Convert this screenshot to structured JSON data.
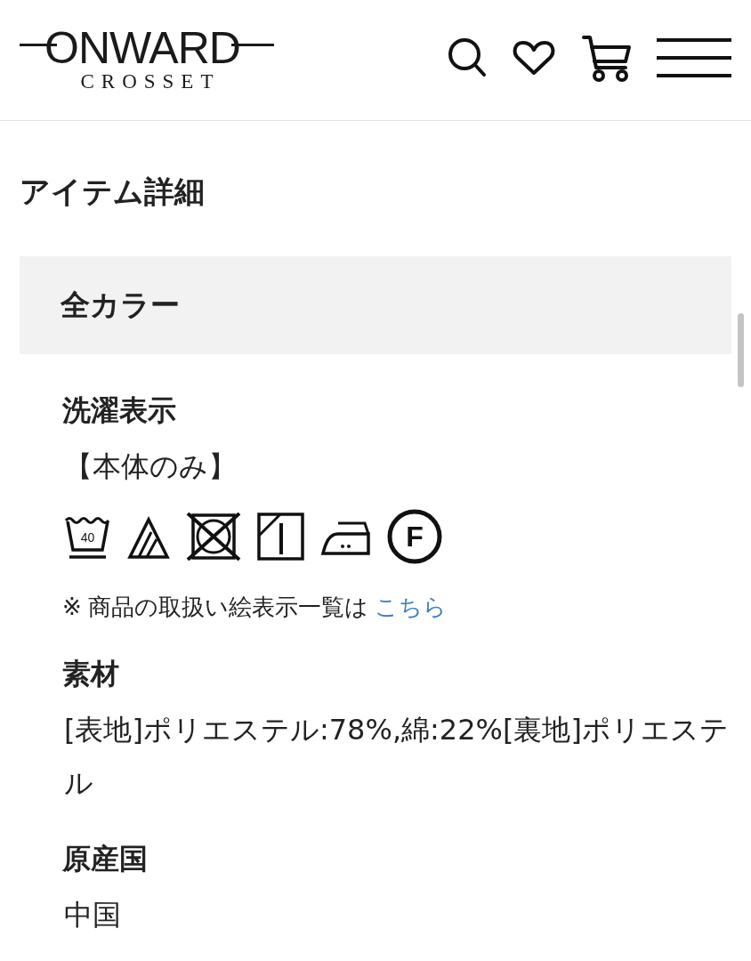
{
  "header": {
    "logo": {
      "wordmark": "ONWARD",
      "tagline": "CROSSET"
    }
  },
  "page_title": "アイテム詳細",
  "color_panel": {
    "label": "全カラー"
  },
  "details": [
    {
      "kind": "care",
      "heading": "洗濯表示",
      "note": "【本体のみ】",
      "symbols": [
        {
          "kind": "wash",
          "label": "40"
        },
        {
          "kind": "bleach"
        },
        {
          "kind": "no-tumble-dry"
        },
        {
          "kind": "shade-dry"
        },
        {
          "kind": "iron-medium"
        },
        {
          "kind": "dry-clean",
          "label": "F"
        }
      ],
      "footnote": {
        "text": "※ 商品の取扱い絵表示一覧は",
        "link": "こちら"
      }
    },
    {
      "kind": "text",
      "heading": "素材",
      "text": "[表地]ポリエステル:78%,綿:22%[裏地]ポリエステル"
    },
    {
      "kind": "text",
      "heading": "原産国",
      "text": "中国"
    }
  ]
}
